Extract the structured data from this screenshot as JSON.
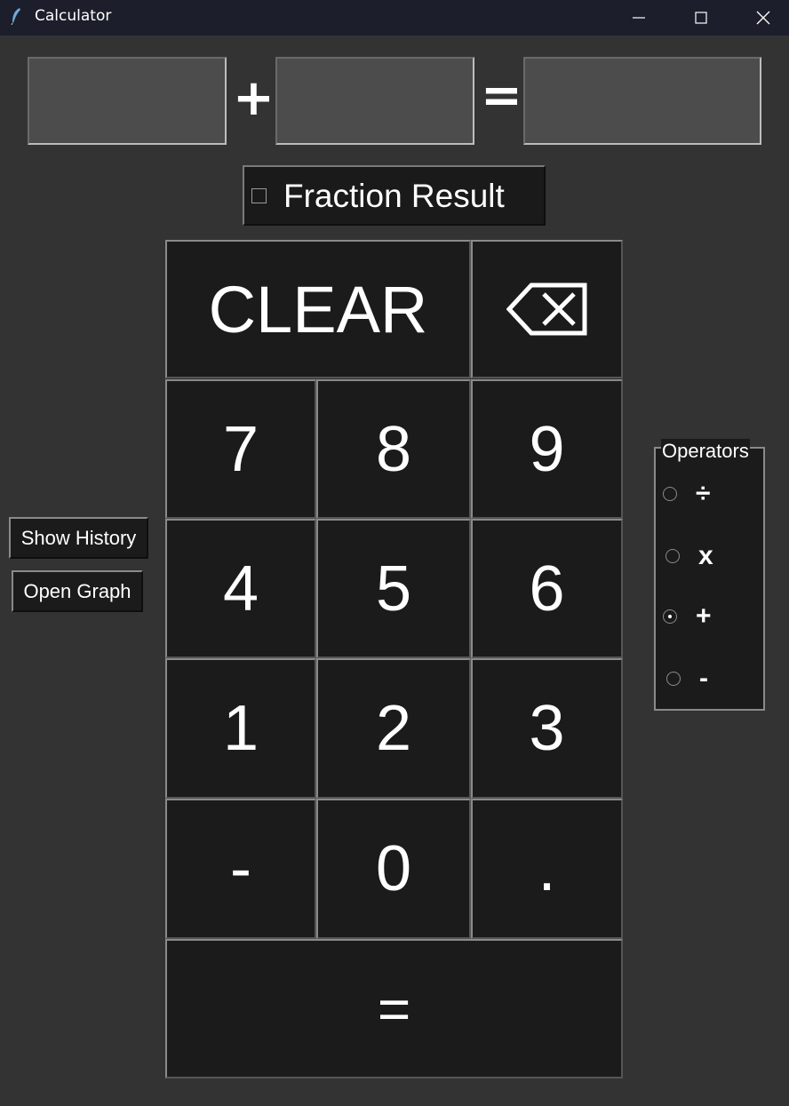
{
  "window": {
    "title": "Calculator",
    "icon": "feather-icon",
    "controls": [
      "minimize-icon",
      "maximize-icon",
      "close-icon"
    ]
  },
  "equation": {
    "operand_a": "",
    "operator": "+",
    "operand_b": "",
    "equals": "=",
    "result": ""
  },
  "fraction": {
    "label": "Fraction Result",
    "checked": false
  },
  "keypad": {
    "clear": "CLEAR",
    "backspace": "⌫",
    "k7": "7",
    "k8": "8",
    "k9": "9",
    "k4": "4",
    "k5": "5",
    "k6": "6",
    "k1": "1",
    "k2": "2",
    "k3": "3",
    "neg": "-",
    "k0": "0",
    "dot": ".",
    "equals": "="
  },
  "side": {
    "show_history": "Show History",
    "open_graph": "Open Graph"
  },
  "operators": {
    "legend": "Operators",
    "options": [
      {
        "label": "÷",
        "selected": false
      },
      {
        "label": "x",
        "selected": false
      },
      {
        "label": "+",
        "selected": true
      },
      {
        "label": "-",
        "selected": false
      }
    ]
  },
  "colors": {
    "background": "#333333",
    "titlebar": "#1c1e2b",
    "button": "#1b1b1b",
    "entry": "#4c4c4c",
    "text": "#ffffff"
  }
}
